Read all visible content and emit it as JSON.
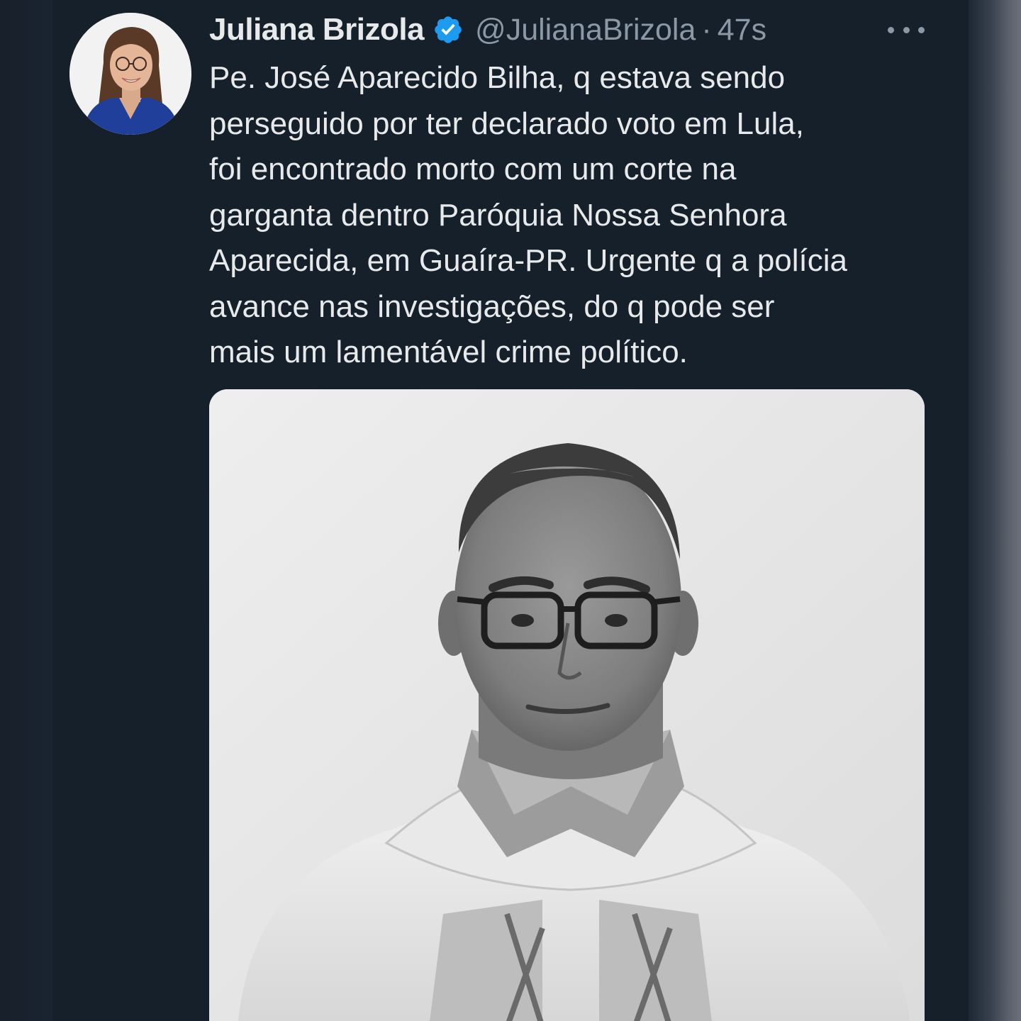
{
  "tweet": {
    "author_name": "Juliana Brizola",
    "handle": "@JulianaBrizola",
    "separator": "·",
    "time": "47s",
    "verified_icon": "verified-badge-icon",
    "more_icon": "more-options-icon",
    "text_lines": [
      "Pe. José Aparecido Bilha, q estava sendo",
      "perseguido por ter declarado voto em Lula,",
      "foi encontrado morto com um corte na",
      "garganta dentro Paróquia Nossa Senhora",
      "Aparecida, em Guaíra-PR. Urgente q a polícia",
      "avance nas investigações, do q pode ser",
      "mais um lamentável crime político."
    ]
  },
  "colors": {
    "background": "#15202b",
    "text_primary": "#e7e9ea",
    "text_secondary": "#8b98a5",
    "verified_blue": "#1d9bf0"
  }
}
